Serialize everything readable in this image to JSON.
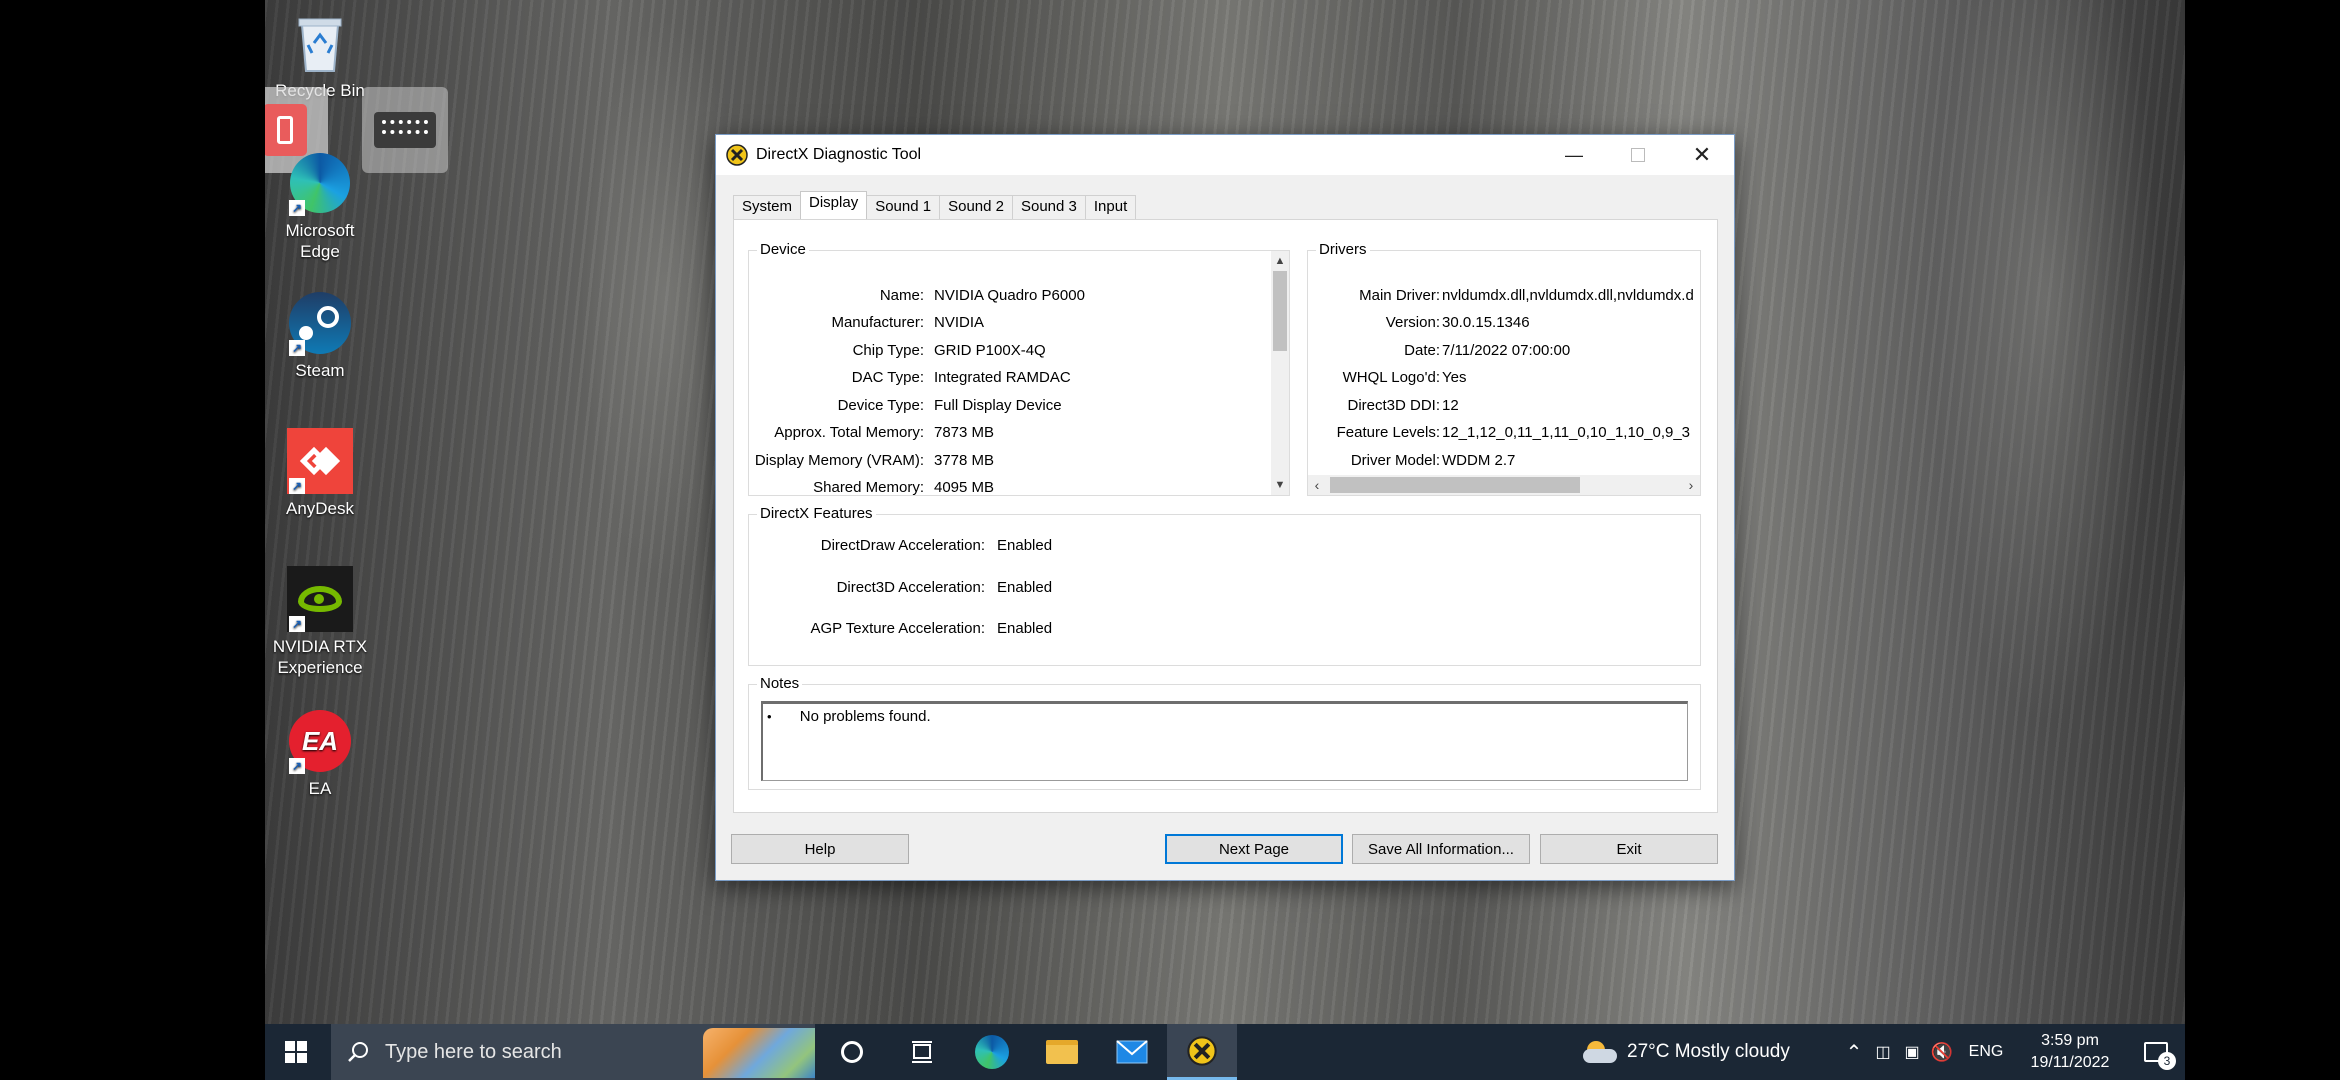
{
  "desktop": {
    "icons": [
      {
        "label": "Recycle Bin",
        "icon": "recycle-bin-icon"
      },
      {
        "label": "Microsoft Edge",
        "icon": "edge-icon"
      },
      {
        "label": "Steam",
        "icon": "steam-icon"
      },
      {
        "label": "AnyDesk",
        "icon": "anydesk-icon"
      },
      {
        "label": "NVIDIA RTX Experience",
        "icon": "nvidia-icon"
      },
      {
        "label": "EA",
        "icon": "ea-icon"
      }
    ],
    "icon_lines": {
      "edge": [
        "Microsoft",
        "Edge"
      ],
      "nvidia": [
        "NVIDIA RTX",
        "Experience"
      ]
    }
  },
  "window": {
    "title": "DirectX Diagnostic Tool",
    "tabs": [
      {
        "label": "System",
        "active": false
      },
      {
        "label": "Display",
        "active": true
      },
      {
        "label": "Sound 1",
        "active": false
      },
      {
        "label": "Sound 2",
        "active": false
      },
      {
        "label": "Sound 3",
        "active": false
      },
      {
        "label": "Input",
        "active": false
      }
    ],
    "device": {
      "label": "Device",
      "rows": [
        {
          "key": "Name:",
          "value": "NVIDIA Quadro P6000"
        },
        {
          "key": "Manufacturer:",
          "value": "NVIDIA"
        },
        {
          "key": "Chip Type:",
          "value": "GRID P100X-4Q"
        },
        {
          "key": "DAC Type:",
          "value": "Integrated RAMDAC"
        },
        {
          "key": "Device Type:",
          "value": "Full Display Device"
        },
        {
          "key": "Approx. Total Memory:",
          "value": "7873 MB"
        },
        {
          "key": "Display Memory (VRAM):",
          "value": "3778 MB"
        },
        {
          "key": "Shared Memory:",
          "value": "4095 MB"
        }
      ]
    },
    "drivers": {
      "label": "Drivers",
      "rows": [
        {
          "key": "Main Driver:",
          "value": "nvldumdx.dll,nvldumdx.dll,nvldumdx.d"
        },
        {
          "key": "Version:",
          "value": "30.0.15.1346"
        },
        {
          "key": "Date:",
          "value": "7/11/2022 07:00:00"
        },
        {
          "key": "WHQL Logo'd:",
          "value": "Yes"
        },
        {
          "key": "Direct3D DDI:",
          "value": "12"
        },
        {
          "key": "Feature Levels:",
          "value": "12_1,12_0,11_1,11_0,10_1,10_0,9_3"
        },
        {
          "key": "Driver Model:",
          "value": "WDDM 2.7"
        }
      ]
    },
    "features": {
      "label": "DirectX Features",
      "rows": [
        {
          "key": "DirectDraw Acceleration:",
          "value": "Enabled"
        },
        {
          "key": "Direct3D Acceleration:",
          "value": "Enabled"
        },
        {
          "key": "AGP Texture Acceleration:",
          "value": "Enabled"
        }
      ]
    },
    "notes": {
      "label": "Notes",
      "bullet": "•",
      "items": [
        "No problems found."
      ]
    },
    "buttons": {
      "help": "Help",
      "next": "Next Page",
      "save": "Save All Information...",
      "exit": "Exit"
    }
  },
  "taskbar": {
    "search_placeholder": "Type here to search",
    "weather": "27°C  Mostly cloudy",
    "language": "ENG",
    "time": "3:59 pm",
    "date": "19/11/2022",
    "notification_count": "3"
  },
  "colors": {
    "taskbar_bg": "#1b2735",
    "accent": "#0078d7",
    "anydesk": "#ef443b",
    "nvidia": "#76b900",
    "ea": "#e4202e"
  }
}
